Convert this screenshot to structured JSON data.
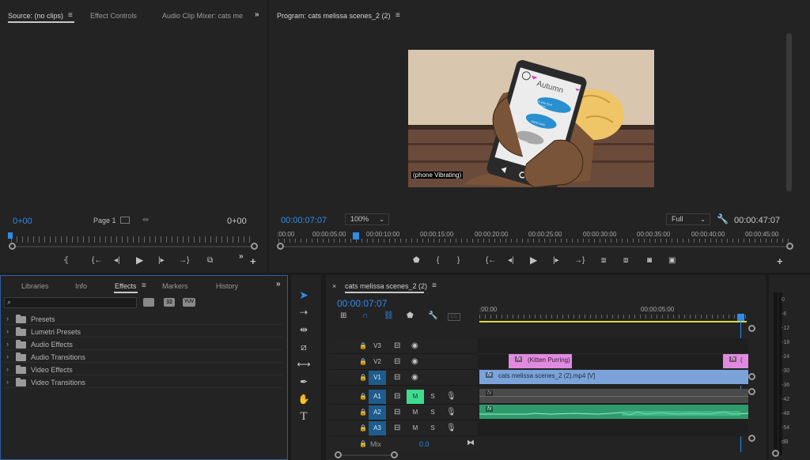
{
  "source": {
    "tabs": [
      {
        "label": "Source: (no clips)",
        "active": true
      },
      {
        "label": "Effect Controls"
      },
      {
        "label": "Audio Clip Mixer: cats me"
      }
    ],
    "timecode_in": "0+00",
    "timecode_out": "0+00",
    "page_select": "Page 1"
  },
  "program": {
    "title": "Program: cats melissa scenes_2 (2)",
    "timecode": "00:00:07:07",
    "zoom": "100%",
    "quality": "Full",
    "duration": "00:00:47:07",
    "ruler_labels": [
      ":00:00",
      "00:00:05:00",
      "00:00:10:00",
      "00:00:15:00",
      "00:00:20:00",
      "00:00:25:00",
      "00:00:30:00",
      "00:00:35:00",
      "00:00:40:00",
      "00:00:45:00"
    ],
    "frame": {
      "caption": "(phone Vibrating)",
      "phone_name": "Autumn",
      "bubble_1": "are you free tonight?",
      "bubble_2": "come over",
      "bubble_3": "sure"
    }
  },
  "project": {
    "tabs": [
      {
        "label": "Libraries"
      },
      {
        "label": "Info"
      },
      {
        "label": "Effects",
        "active": true
      },
      {
        "label": "Markers"
      },
      {
        "label": "History"
      }
    ],
    "search_placeholder": "",
    "badges": [
      "32",
      "YUV"
    ],
    "items": [
      {
        "label": "Presets",
        "icon": "preset-folder-icon"
      },
      {
        "label": "Lumetri Presets",
        "icon": "preset-folder-icon"
      },
      {
        "label": "Audio Effects",
        "icon": "folder-icon"
      },
      {
        "label": "Audio Transitions",
        "icon": "folder-icon"
      },
      {
        "label": "Video Effects",
        "icon": "folder-icon"
      },
      {
        "label": "Video Transitions",
        "icon": "folder-icon"
      }
    ]
  },
  "timeline": {
    "title": "cats melissa scenes_2 (2)",
    "timecode": "00:00:07:07",
    "ruler_labels": [
      ":00:00",
      "00:00:05:00"
    ],
    "cc_label": "CC",
    "tracks": [
      {
        "name": "V3",
        "target": ""
      },
      {
        "name": "V2",
        "target": ""
      },
      {
        "name": "V1",
        "target": "V1"
      },
      {
        "name": "A1",
        "target": "A1",
        "m": "M",
        "s": "S"
      },
      {
        "name": "A2",
        "target": "A2",
        "m": "M",
        "s": "S"
      },
      {
        "name": "A3",
        "target": "A3",
        "m": "M",
        "s": "S"
      }
    ],
    "mix": {
      "label": "Mix",
      "value": "0.0"
    },
    "clips": {
      "v2_title": "(Kitten Purring)",
      "v2_end": "(",
      "v1_clip": "cats melissa scenes_2 (2).mp4 [V]",
      "fx": "fx"
    }
  },
  "meter": {
    "labels": [
      "0",
      "-6",
      "-12",
      "-18",
      "-24",
      "-30",
      "-36",
      "-42",
      "-48",
      "-54",
      "dB"
    ]
  },
  "colors": {
    "accent": "#2d8ceb",
    "v_clip": "#7ba3d9",
    "title_clip": "#e08ae0",
    "audio_clip": "#2f9b6d",
    "mute_on": "#3fdc8f"
  }
}
